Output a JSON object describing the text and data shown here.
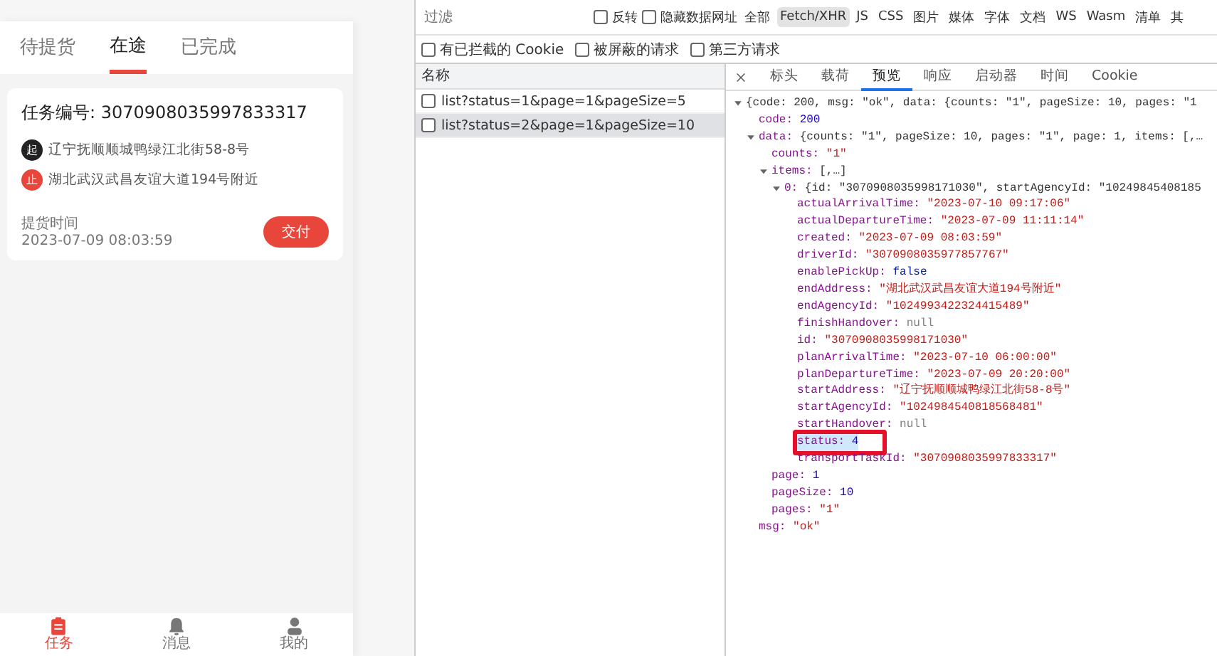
{
  "app": {
    "tabs": [
      {
        "label": "待提货",
        "selected": false
      },
      {
        "label": "在途",
        "selected": true
      },
      {
        "label": "已完成",
        "selected": false
      }
    ],
    "task": {
      "title": "任务编号: 3070908035997833317",
      "stops": [
        {
          "kind": "start",
          "badge": "起",
          "address": "辽宁抚顺顺城鸭绿江北街58-8号"
        },
        {
          "kind": "end",
          "badge": "止",
          "address": "湖北武汉武昌友谊大道194号附近"
        }
      ],
      "time_label": "提货时间",
      "time": "2023-07-09 08:03:59",
      "button": "交付"
    },
    "bottom_nav": [
      {
        "kind": "task",
        "label": "任务",
        "selected": true
      },
      {
        "kind": "message",
        "label": "消息",
        "selected": false
      },
      {
        "kind": "profile",
        "label": "我的",
        "selected": false
      }
    ]
  },
  "devtools": {
    "filter": {
      "placeholder": "过滤"
    },
    "filter_checks": [
      {
        "label": "反转",
        "checked": false
      },
      {
        "label": "隐藏数据网址",
        "checked": false
      }
    ],
    "type_filters": [
      {
        "label": "全部",
        "selected": false
      },
      {
        "label": "Fetch/XHR",
        "selected": true
      },
      {
        "label": "JS",
        "selected": false
      },
      {
        "label": "CSS",
        "selected": false
      },
      {
        "label": "图片",
        "selected": false
      },
      {
        "label": "媒体",
        "selected": false
      },
      {
        "label": "字体",
        "selected": false
      },
      {
        "label": "文档",
        "selected": false
      },
      {
        "label": "WS",
        "selected": false
      },
      {
        "label": "Wasm",
        "selected": false
      },
      {
        "label": "清单",
        "selected": false
      },
      {
        "label": "其",
        "selected": false
      }
    ],
    "extra_checks": [
      {
        "label": "有已拦截的 Cookie",
        "checked": false
      },
      {
        "label": "被屏蔽的请求",
        "checked": false
      },
      {
        "label": "第三方请求",
        "checked": false
      }
    ],
    "requests": {
      "column": "名称",
      "rows": [
        {
          "name": "list?status=1&page=1&pageSize=5",
          "selected": false
        },
        {
          "name": "list?status=2&page=1&pageSize=10",
          "selected": true
        }
      ]
    },
    "detail_tabs": [
      {
        "label": "标头",
        "selected": false
      },
      {
        "label": "载荷",
        "selected": false
      },
      {
        "label": "预览",
        "selected": true
      },
      {
        "label": "响应",
        "selected": false
      },
      {
        "label": "启动器",
        "selected": false
      },
      {
        "label": "时间",
        "selected": false
      },
      {
        "label": "Cookie",
        "selected": false
      }
    ],
    "preview": [
      {
        "summary": "{code: 200, msg: \"ok\", data: {counts: \"1\", pageSize: 10, pages: \"1",
        "expanded": true,
        "children": [
          {
            "key": "code:",
            "value": "200",
            "kind": "number"
          },
          {
            "key": "data:",
            "summary": "{counts: \"1\", pageSize: 10, pages: \"1\", page: 1, items: [,…",
            "expanded": true,
            "children": [
              {
                "key": "counts:",
                "value": "\"1\"",
                "kind": "string"
              },
              {
                "key": "items:",
                "summary": "[,…]",
                "expanded": true,
                "children": [
                  {
                    "key": "0:",
                    "summary": "{id: \"3070908035998171030\", startAgencyId: \"10249845408185",
                    "expanded": true,
                    "children": [
                      {
                        "key": "actualArrivalTime:",
                        "value": "\"2023-07-10 09:17:06\"",
                        "kind": "string"
                      },
                      {
                        "key": "actualDepartureTime:",
                        "value": "\"2023-07-09 11:11:14\"",
                        "kind": "string"
                      },
                      {
                        "key": "created:",
                        "value": "\"2023-07-09 08:03:59\"",
                        "kind": "string"
                      },
                      {
                        "key": "driverId:",
                        "value": "\"3070908035977857767\"",
                        "kind": "string"
                      },
                      {
                        "key": "enablePickUp:",
                        "value": "false",
                        "kind": "bool"
                      },
                      {
                        "key": "endAddress:",
                        "value": "\"湖北武汉武昌友谊大道194号附近\"",
                        "kind": "string"
                      },
                      {
                        "key": "endAgencyId:",
                        "value": "\"1024993422324415489\"",
                        "kind": "string"
                      },
                      {
                        "key": "finishHandover:",
                        "value": "null",
                        "kind": "null"
                      },
                      {
                        "key": "id:",
                        "value": "\"3070908035998171030\"",
                        "kind": "string"
                      },
                      {
                        "key": "planArrivalTime:",
                        "value": "\"2023-07-10 06:00:00\"",
                        "kind": "string"
                      },
                      {
                        "key": "planDepartureTime:",
                        "value": "\"2023-07-09 20:20:00\"",
                        "kind": "string"
                      },
                      {
                        "key": "startAddress:",
                        "value": "\"辽宁抚顺顺城鸭绿江北街58-8号\"",
                        "kind": "string"
                      },
                      {
                        "key": "startAgencyId:",
                        "value": "\"1024984540818568481\"",
                        "kind": "string"
                      },
                      {
                        "key": "startHandover:",
                        "value": "null",
                        "kind": "null"
                      },
                      {
                        "key": "status:",
                        "value": "4",
                        "kind": "number",
                        "highlighted": true
                      },
                      {
                        "key": "transportTaskId:",
                        "value": "\"3070908035997833317\"",
                        "kind": "string"
                      }
                    ]
                  }
                ]
              },
              {
                "key": "page:",
                "value": "1",
                "kind": "number"
              },
              {
                "key": "pageSize:",
                "value": "10",
                "kind": "number"
              },
              {
                "key": "pages:",
                "value": "\"1\"",
                "kind": "string"
              }
            ]
          },
          {
            "key": "msg:",
            "value": "\"ok\"",
            "kind": "string"
          }
        ]
      }
    ]
  }
}
